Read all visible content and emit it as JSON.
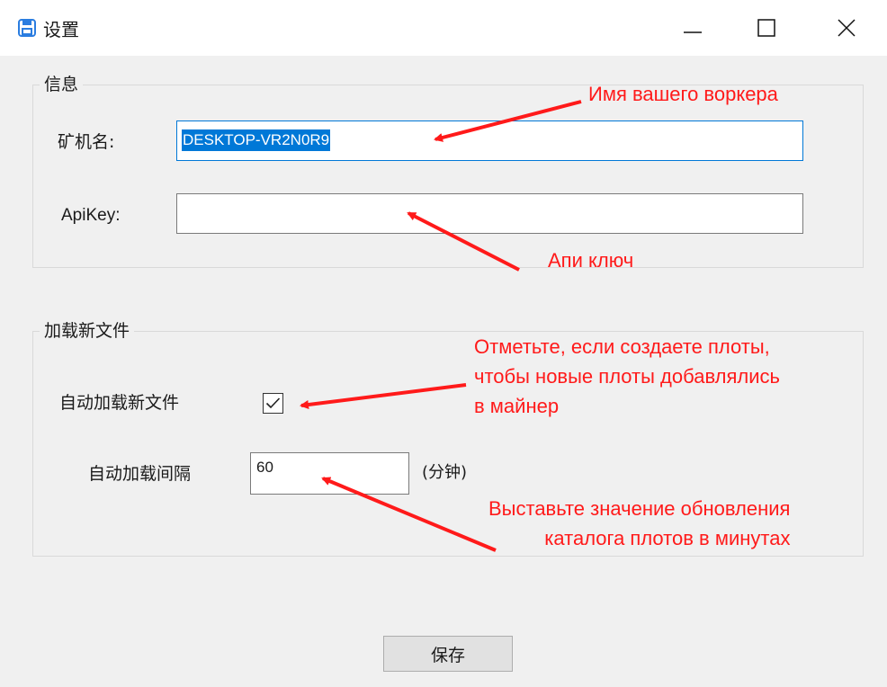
{
  "window": {
    "title": "设置",
    "icon": "floppy-disk-icon",
    "accent_color": "#0078d7"
  },
  "info_group": {
    "legend": "信息",
    "miner_name_label": "矿机名:",
    "miner_name_value": "DESKTOP-VR2N0R9",
    "apikey_label": "ApiKey:",
    "apikey_value": ""
  },
  "load_group": {
    "legend": "加载新文件",
    "autoload_label": "自动加载新文件",
    "autoload_checked": true,
    "interval_label": "自动加载间隔",
    "interval_value": "60",
    "interval_unit": "(分钟)"
  },
  "save_button": "保存",
  "annotations": {
    "color": "#ff1a1a",
    "worker_name": "Имя вашего воркера",
    "api_key": "Апи ключ",
    "checkbox_lines": [
      "Отметьте, если создаете плоты,",
      "чтобы новые плоты добавлялись",
      "в майнер"
    ],
    "interval_lines": [
      "Выставьте значение обновления",
      "каталога плотов в минутах"
    ]
  }
}
